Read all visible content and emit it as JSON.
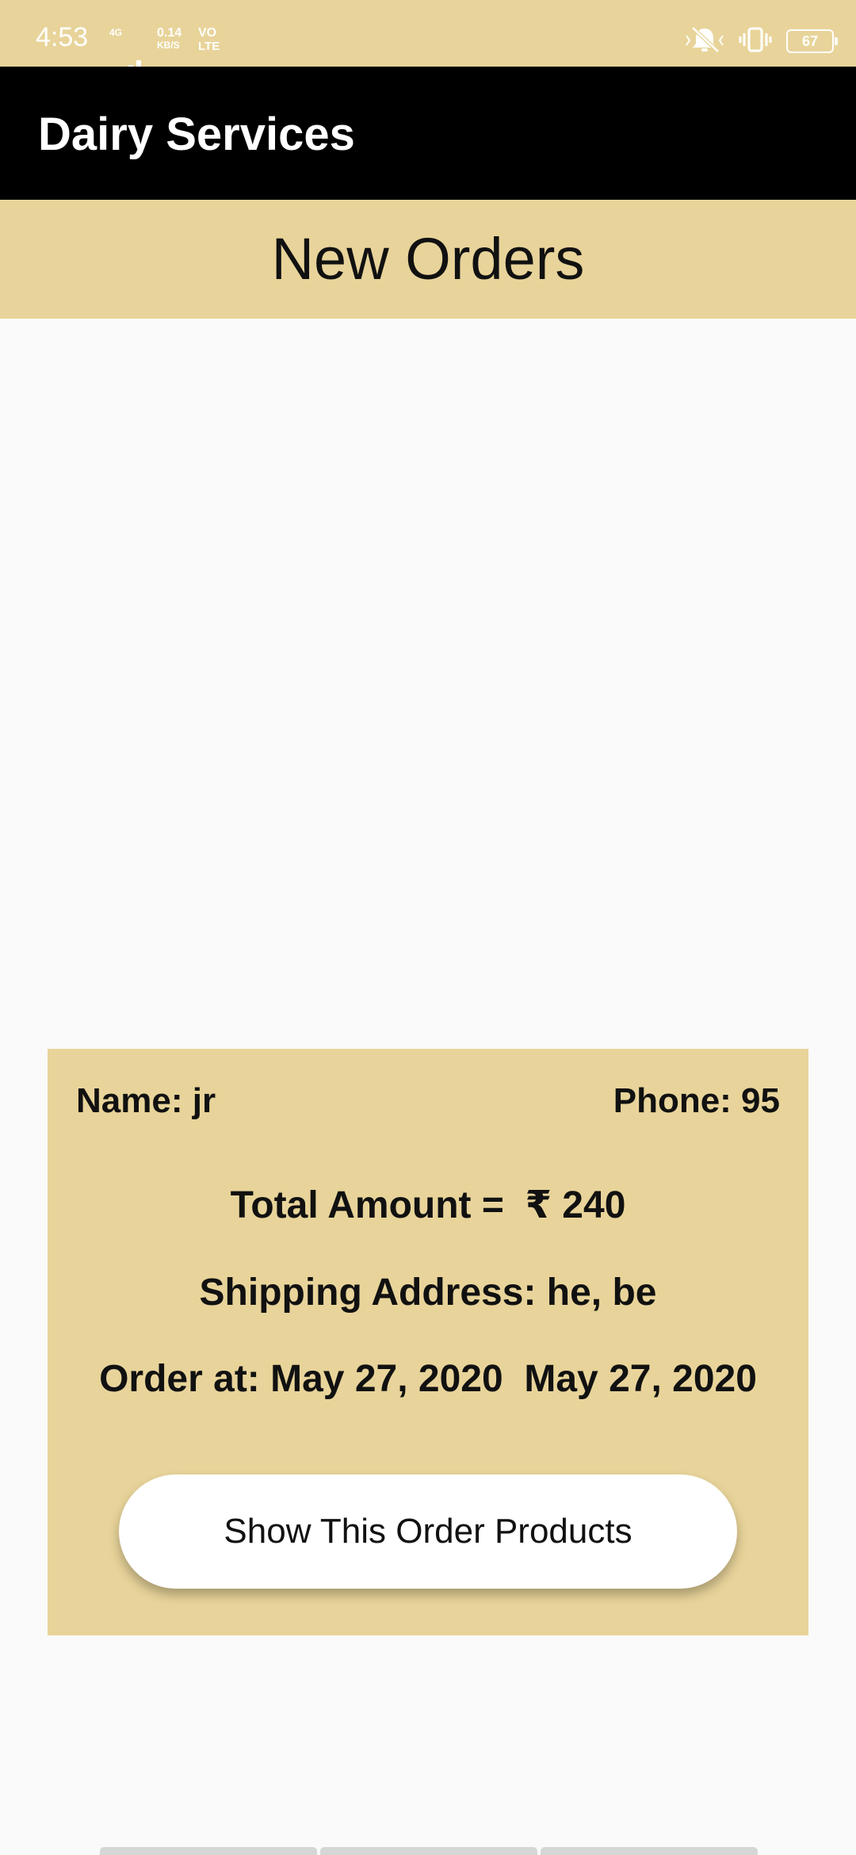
{
  "status_bar": {
    "time": "4:53",
    "network": "4G",
    "speed_value": "0.14",
    "speed_unit": "KB/S",
    "volte_top": "VO",
    "volte_bottom": "LTE",
    "battery": "67",
    "icons": [
      "mute-icon",
      "vibrate-icon",
      "battery-icon"
    ]
  },
  "app_bar": {
    "title": "Dairy Services"
  },
  "header": {
    "title": "New Orders"
  },
  "order": {
    "name": "Name: jr",
    "phone": "Phone: 95",
    "total": "Total Amount =  ₹ 240",
    "address": "Shipping Address: he, be",
    "order_at": "Order at: May 27, 2020  May 27, 2020",
    "button_label": "Show This Order Products"
  },
  "colors": {
    "accent": "#e8d49a",
    "app_bar": "#000000",
    "background": "#fafafa"
  }
}
